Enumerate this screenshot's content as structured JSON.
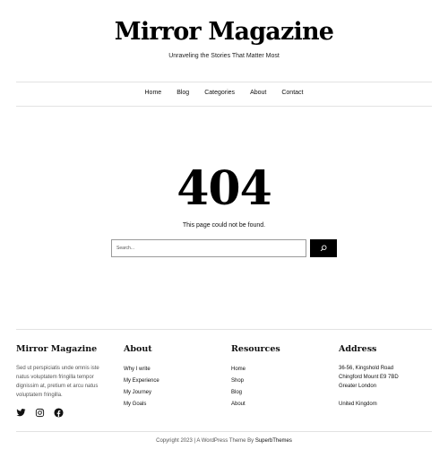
{
  "header": {
    "site_title": "Mirror Magazine",
    "tagline": "Unraveling the Stories That Matter Most"
  },
  "nav": {
    "items": [
      {
        "label": "Home"
      },
      {
        "label": "Blog"
      },
      {
        "label": "Categories"
      },
      {
        "label": "About"
      },
      {
        "label": "Contact"
      }
    ]
  },
  "main": {
    "error_code": "404",
    "message": "This page could not be found.",
    "search": {
      "placeholder": "Search...",
      "value": "",
      "icon": "search-icon"
    }
  },
  "footer": {
    "brand": {
      "title": "Mirror Magazine",
      "description": "Sed ut perspiciatis unde omnis iste natus voluptatem fringilla tempor dignissim at, pretium et arcu natus voluptatem fringilla.",
      "social": [
        {
          "icon": "twitter-icon"
        },
        {
          "icon": "instagram-icon"
        },
        {
          "icon": "facebook-icon"
        }
      ]
    },
    "about": {
      "title": "About",
      "links": [
        "Why I write",
        "My Experience",
        "My Journey",
        "My Goals"
      ]
    },
    "resources": {
      "title": "Resources",
      "links": [
        "Home",
        "Shop",
        "Blog",
        "About"
      ]
    },
    "address": {
      "title": "Address",
      "line1": "36-56, Kingshold Road",
      "line2": "Chingford Mount E9 7BD",
      "line3": "Greater London",
      "country": "United Kingdom"
    },
    "copyright_prefix": "Copyright 2023 | A WordPress Theme By",
    "copyright_brand": "SuperbThemes"
  }
}
